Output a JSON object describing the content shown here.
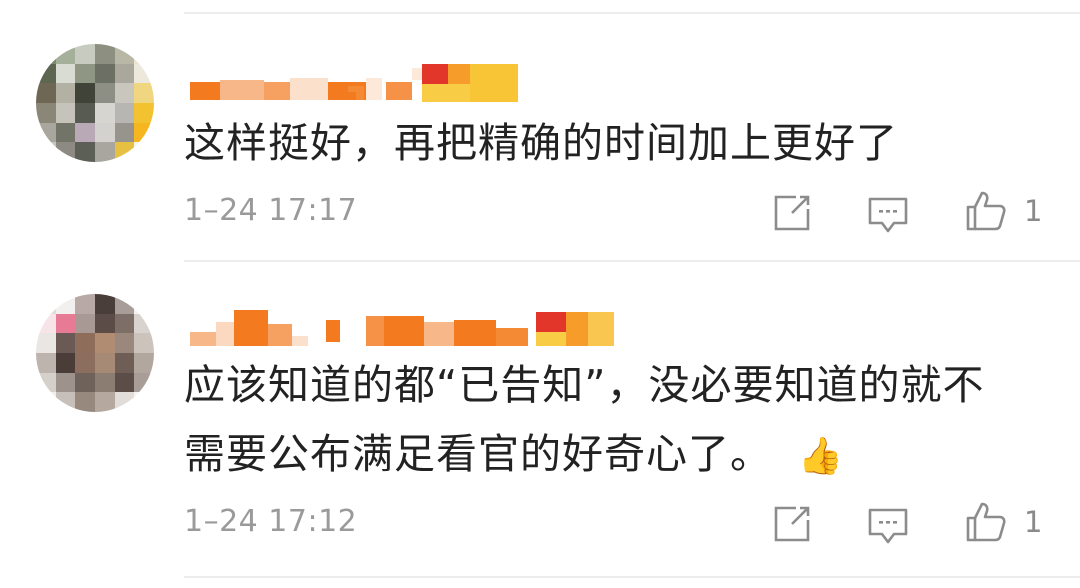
{
  "comments": [
    {
      "text_line1": "这样挺好，再把精确的时间加上更好了",
      "text_line2": "",
      "time": "1–24 17:17",
      "like_count": "1"
    },
    {
      "text_line1": "应该知道的都“已告知”，没必要知道的就不",
      "text_line2": "需要公布满足看官的好奇心了。",
      "emoji": "👍",
      "time": "1–24 17:12",
      "like_count": "1"
    }
  ],
  "colors": {
    "name_orange": "#f47a20",
    "badge_yellow": "#f7b82c",
    "text": "#222222",
    "meta": "#9a9a9a"
  },
  "icons": [
    "forward-icon",
    "comment-icon",
    "like-icon"
  ]
}
